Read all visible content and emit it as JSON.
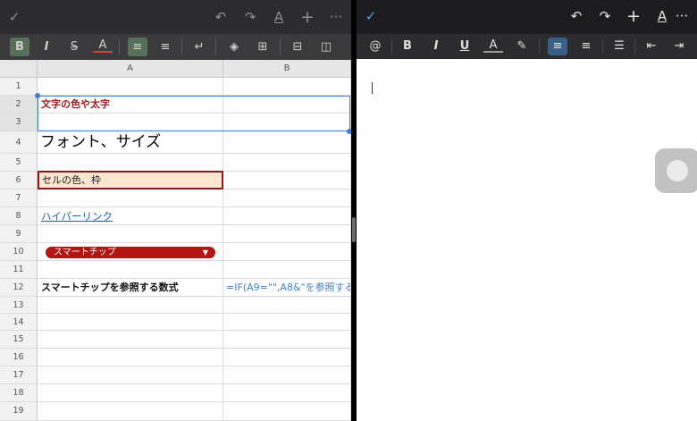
{
  "left_pane": {
    "toolbar": {
      "done_icon": "checkmark-icon",
      "undo_icon": "undo-icon",
      "redo_icon": "redo-icon",
      "text_format_icon": "text-format-icon",
      "insert_icon": "plus-icon",
      "more_icon": "more-icon"
    },
    "format_bar": {
      "bold": "B",
      "italic": "I",
      "strikethrough": "S",
      "text_color": "A"
    },
    "columns": [
      "A",
      "B"
    ],
    "rows": [
      "1",
      "2",
      "3",
      "4",
      "5",
      "6",
      "7",
      "8",
      "9",
      "10",
      "11",
      "12",
      "13",
      "14",
      "15",
      "16",
      "17",
      "18",
      "19"
    ],
    "cells": {
      "a2": "文字の色や太字",
      "a4": "フォント、サイズ",
      "a6": "セルの色、枠",
      "a8": "ハイパーリンク",
      "a10_chip": "スマートチップ",
      "a12": "スマートチップを参照する数式",
      "b12": "=IF(A9=\"\",A8&\"を参照する"
    },
    "colors": {
      "red_text": "#a01b1b",
      "cell_fill": "#fde6cf",
      "cell_border": "#8b1a1a",
      "chip": "#b31414",
      "link": "#1a62b8",
      "selection": "#3b7fd4"
    }
  },
  "right_pane": {
    "toolbar": {
      "done_icon": "checkmark-icon",
      "undo_icon": "undo-icon",
      "redo_icon": "redo-icon",
      "insert_icon": "plus-icon",
      "text_format_icon": "text-format-icon",
      "more_icon": "more-icon"
    },
    "format_bar": {
      "mention": "@",
      "bold": "B",
      "italic": "I",
      "underline": "U",
      "text_color": "A"
    }
  }
}
